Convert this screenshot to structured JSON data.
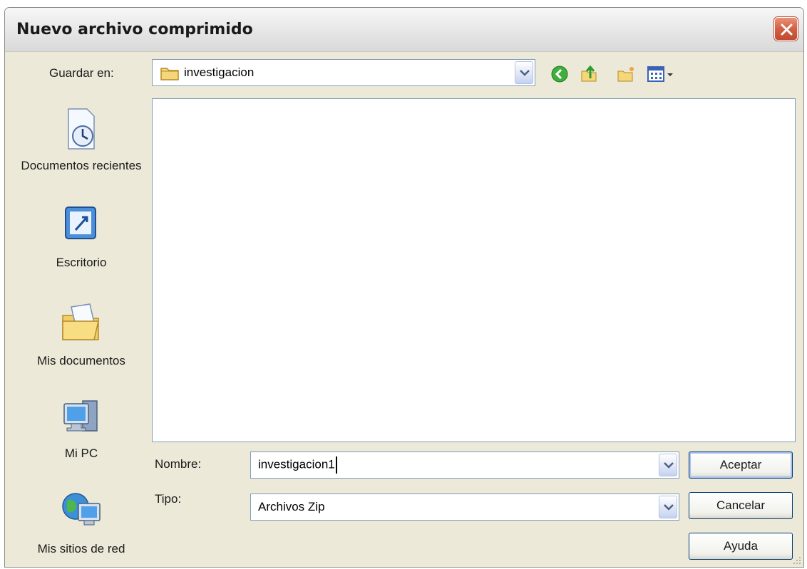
{
  "window": {
    "title": "Nuevo archivo comprimido"
  },
  "save_in": {
    "label": "Guardar en:",
    "value": "investigacion"
  },
  "toolbar": {
    "icons": [
      "back-icon",
      "up-folder-icon",
      "new-folder-icon",
      "view-menu-icon"
    ]
  },
  "places": [
    {
      "label": "Documentos recientes",
      "icon": "recent-documents-icon"
    },
    {
      "label": "Escritorio",
      "icon": "desktop-icon"
    },
    {
      "label": "Mis documentos",
      "icon": "my-documents-icon"
    },
    {
      "label": "Mi PC",
      "icon": "my-computer-icon"
    },
    {
      "label": "Mis sitios de red",
      "icon": "network-places-icon"
    }
  ],
  "filename": {
    "label": "Nombre:",
    "value": "investigacion1"
  },
  "filetype": {
    "label": "Tipo:",
    "value": "Archivos Zip"
  },
  "buttons": {
    "accept": "Aceptar",
    "cancel": "Cancelar",
    "help": "Ayuda"
  },
  "colors": {
    "close_button": "#d35f43",
    "field_border": "#7f9db9",
    "dialog_bg": "#ece9d8"
  }
}
